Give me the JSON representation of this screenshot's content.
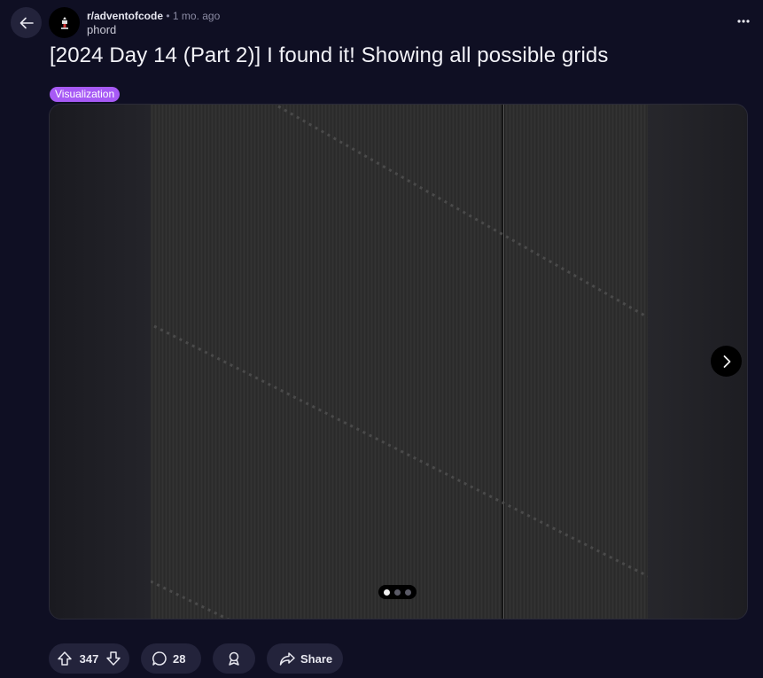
{
  "header": {
    "subreddit": "r/adventofcode",
    "separator": "•",
    "time_ago": "1 mo. ago",
    "author": "phord"
  },
  "post": {
    "title": "[2024 Day 14 (Part 2)] I found it! Showing all possible grids",
    "flair": "Visualization",
    "flair_color": "#a75af5"
  },
  "gallery": {
    "total_slides": 3,
    "current_slide": 1
  },
  "actions": {
    "score": "347",
    "comments": "28",
    "share_label": "Share"
  },
  "colors": {
    "background": "#0f0f23",
    "button_bg": "#23233b"
  }
}
